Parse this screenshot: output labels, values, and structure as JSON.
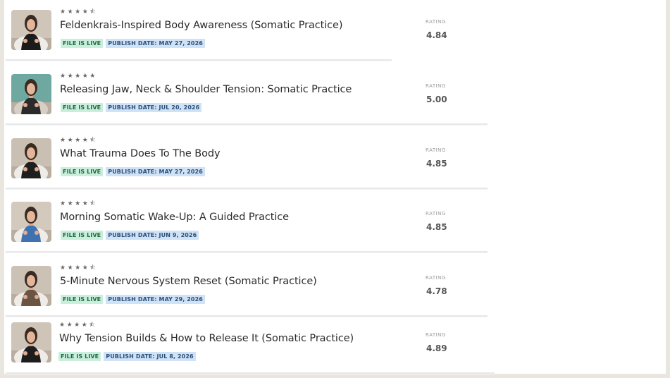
{
  "videos": [
    {
      "stars": "★★★★⯪",
      "title": "Feldenkrais-Inspired Body Awareness (Somatic Practice)",
      "status": "FILE IS LIVE",
      "publish": "PUBLISH DATE: MAY 27, 2026",
      "rating_label": "RATING",
      "rating": "4.84",
      "outfit": "#1b1b1b",
      "bg": "#cfc5b8",
      "chair": "#efece7"
    },
    {
      "stars": "★★★★★",
      "title": "Releasing Jaw, Neck & Shoulder Tension: Somatic Practice",
      "status": "FILE IS LIVE",
      "publish": "PUBLISH DATE: JUL 20, 2026",
      "rating_label": "RATING",
      "rating": "5.00",
      "outfit": "#2b2b2b",
      "bg": "#6fa8a0",
      "chair": "#d7cfc6"
    },
    {
      "stars": "★★★★⯪",
      "title": "What Trauma Does To The Body",
      "status": "FILE IS LIVE",
      "publish": "PUBLISH DATE: MAY 27, 2026",
      "rating_label": "RATING",
      "rating": "4.85",
      "outfit": "#1e1e1e",
      "bg": "#c9bfb2",
      "chair": "#efece7"
    },
    {
      "stars": "★★★★⯪",
      "title": "Morning Somatic Wake-Up: A Guided Practice",
      "status": "FILE IS LIVE",
      "publish": "PUBLISH DATE: JUN 9, 2026",
      "rating_label": "RATING",
      "rating": "4.85",
      "outfit": "#3e72b0",
      "bg": "#d3c9bd",
      "chair": "#efece7"
    },
    {
      "stars": "★★★★⯪",
      "title": "5-Minute Nervous System Reset (Somatic Practice)",
      "status": "FILE IS LIVE",
      "publish": "PUBLISH DATE: MAY 29, 2026",
      "rating_label": "RATING",
      "rating": "4.78",
      "outfit": "#6a5444",
      "bg": "#cbc1b4",
      "chair": "#efece7"
    },
    {
      "stars": "★★★★⯪",
      "title": "Why Tension Builds & How to Release It (Somatic Practice)",
      "status": "FILE IS LIVE",
      "publish": "PUBLISH DATE: JUL 8, 2026",
      "rating_label": "RATING",
      "rating": "4.89",
      "outfit": "#1d1d1d",
      "bg": "#cec4b7",
      "chair": "#efece7"
    }
  ]
}
